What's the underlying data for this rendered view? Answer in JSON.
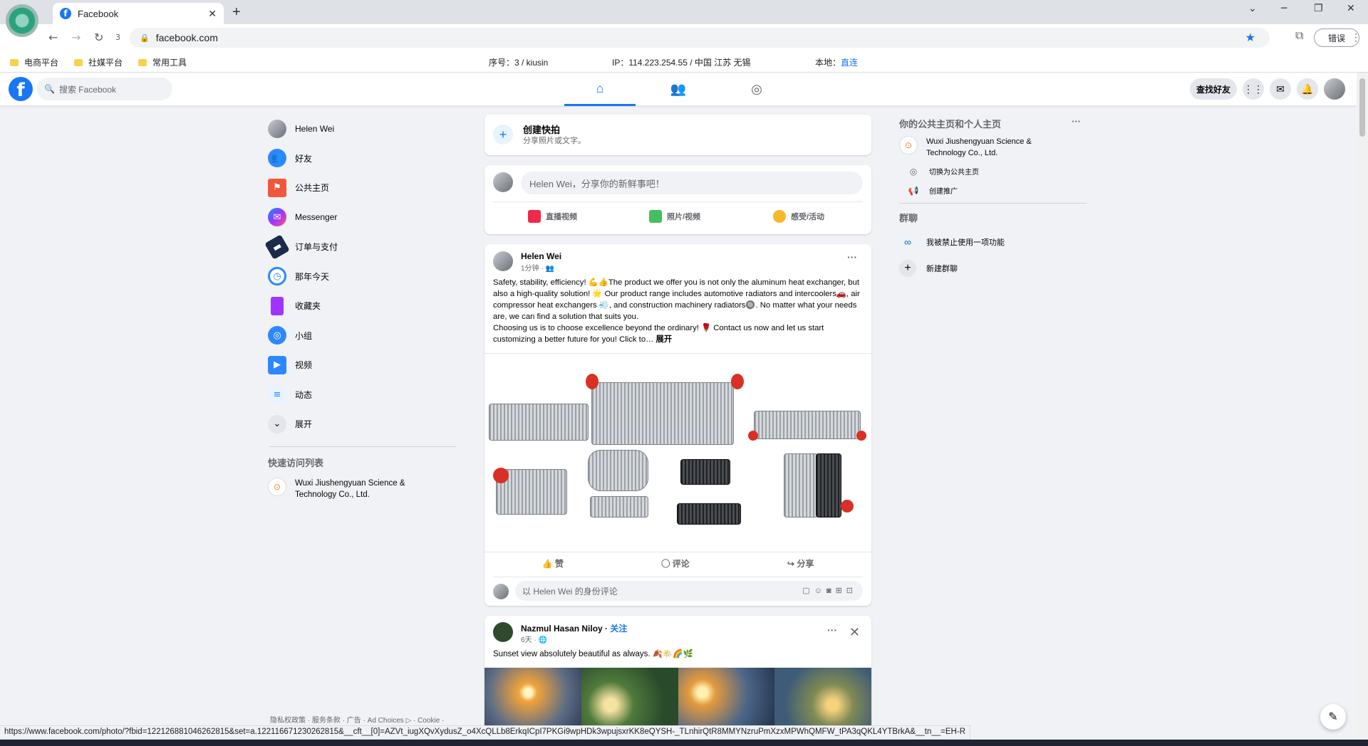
{
  "browser": {
    "tab_title": "Facebook",
    "tab_count": "3",
    "url": "facebook.com",
    "profile_label": "错误",
    "bookmarks": [
      "电商平台",
      "社媒平台",
      "常用工具"
    ],
    "info": {
      "serial": "序号：3 / kiusin",
      "ip": "IP：114.223.254.55 / 中国 江苏 无锡",
      "local_label": "本地：",
      "local_value": "直连"
    },
    "status_url": "https://www.facebook.com/photo/?fbid=122126881046262815&set=a.122116671230262815&__cft__[0]=AZVt_iugXQvXydusZ_o4XcQLLb8ErkqICpI7PKGi9wpHDk3wpujsxrKK8eQYSH-_TLnhirQtR8MMYNzruPmXzxMPWhQMFW_tPA3qQKL4YTBrkA&__tn__=EH-R"
  },
  "header": {
    "logo": "f",
    "search_placeholder": "搜索 Facebook",
    "find_friends": "查找好友"
  },
  "left_nav": {
    "items": [
      {
        "label": "Helen Wei"
      },
      {
        "label": "好友"
      },
      {
        "label": "公共主页"
      },
      {
        "label": "Messenger"
      },
      {
        "label": "订单与支付"
      },
      {
        "label": "那年今天"
      },
      {
        "label": "收藏夹"
      },
      {
        "label": "小组"
      },
      {
        "label": "视频"
      },
      {
        "label": "动态"
      },
      {
        "label": "展开"
      }
    ],
    "shortcuts_title": "快速访问列表",
    "shortcut": "Wuxi Jiushengyuan Science & Technology Co., Ltd.",
    "footer": "隐私权政策 · 服务条款 · 广告 · Ad Choices ▷ · Cookie ·"
  },
  "feed": {
    "create_reel": {
      "title": "创建快拍",
      "subtitle": "分享照片或文字。"
    },
    "composer": {
      "placeholder": "Helen Wei，分享你的新鲜事吧！",
      "live": "直播视频",
      "photo": "照片/视频",
      "feeling": "感受/活动"
    },
    "post1": {
      "author": "Helen Wei",
      "meta": "1分钟 · ",
      "text": "Safety, stability, efficiency! 💪👍The product we offer you is not only the aluminum heat exchanger, but also a high-quality solution! 🌟 Our product range includes automotive radiators and intercoolers🚗, air compressor heat exchangers 💨, and construction machinery radiators🔘. No matter what your needs are, we can find a solution that suits you.\nChoosing us is to choose excellence beyond the ordinary! 🌹 Contact us now and let us start customizing a better future for you! Click to… ",
      "see_more": "展开",
      "like": "赞",
      "comment": "评论",
      "share": "分享",
      "comment_placeholder": "以 Helen Wei 的身份评论"
    },
    "post2": {
      "author": "Nazmul Hasan Niloy",
      "follow": "关注",
      "meta": "6天 · 🌐",
      "text": "Sunset view absolutely beautiful as always. 🍂🌤️🌈🌿"
    }
  },
  "right_col": {
    "pages_title": "你的公共主页和个人主页",
    "page_name": "Wuxi Jiushengyuan Science & Technology Co., Ltd.",
    "switch_label": "切换为公共主页",
    "promote_label": "创建推广",
    "chats_title": "群聊",
    "meta_item": "我被禁止使用一项功能",
    "new_group": "新建群聊"
  },
  "colors": {
    "brand": "#1877f2",
    "background": "#f0f2f5"
  }
}
